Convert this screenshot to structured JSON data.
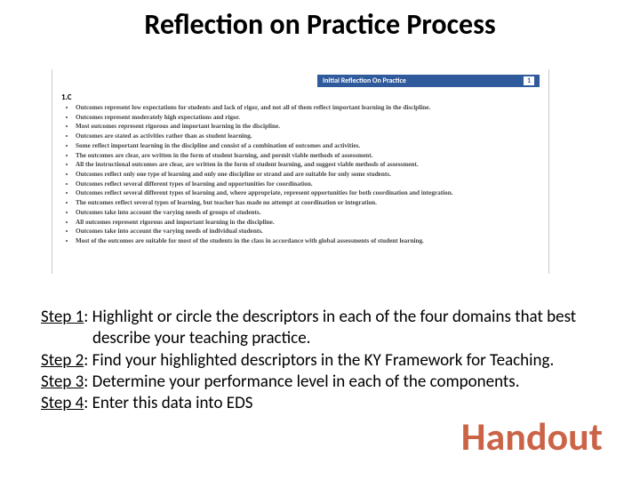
{
  "title": "Reflection on Practice Process",
  "doc": {
    "header_label": "Initial Reflection On Practice",
    "header_number": "1",
    "section_code": "1.C",
    "bullets": [
      "Outcomes represent low expectations for students and lack of rigor, and not all of them reflect important learning in the discipline.",
      "Outcomes represent moderately high expectations and rigor.",
      "Most outcomes represent rigorous and important learning in the discipline.",
      "Outcomes are stated as activities rather than as student learning.",
      "Some reflect important learning in the discipline and consist of a combination of outcomes and activities.",
      "The outcomes are clear, are written in the form of student learning, and permit viable methods of assessment.",
      "All the instructional outcomes are clear, are written in the form of student learning, and suggest viable methods of assessment.",
      "Outcomes reflect only one type of learning and only one discipline or strand and are suitable for only some students.",
      "Outcomes reflect several different types of learning and opportunities for coordination.",
      "Outcomes reflect several different types of learning and, where appropriate, represent opportunities for both coordination and integration.",
      "The outcomes reflect several types of learning, but teacher has made no attempt at coordination or integration.",
      "Outcomes take into account the varying needs of groups of students.",
      "All outcomes represent rigorous and important learning in the discipline.",
      "Outcomes take into account the varying needs of individual students.",
      "Most of the outcomes are suitable for most of the students in the class in accordance with global assessments of student learning."
    ]
  },
  "steps": [
    {
      "label": "Step 1",
      "text": ": Highlight or circle the descriptors in each of the four domains that best describe your teaching practice."
    },
    {
      "label": "Step 2",
      "text": ": Find your highlighted descriptors in the KY Framework for Teaching."
    },
    {
      "label": "Step 3",
      "text": ": Determine your performance level in each of the components."
    },
    {
      "label": "Step 4",
      "text": ": Enter this data into EDS"
    }
  ],
  "handout_label": "Handout"
}
